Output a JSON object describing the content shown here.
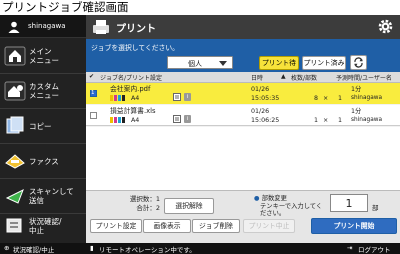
{
  "caption": "プリントジョブ確認画面",
  "sidebar": {
    "user": "shinagawa",
    "items": [
      {
        "label": "メイン\nメニュー"
      },
      {
        "label": "カスタム\nメニュー"
      },
      {
        "label": "コピー"
      },
      {
        "label": "ファクス"
      },
      {
        "label": "スキャンして\n送信"
      },
      {
        "label": "状況確認/\n中止"
      }
    ]
  },
  "header": {
    "title": "プリント"
  },
  "toolbar": {
    "instruction": "ジョブを選択してください。",
    "filter_value": "個人",
    "tab_waiting": "プリント待ち",
    "tab_done": "プリント済み"
  },
  "columns": {
    "name": "ジョブ名/プリント設定",
    "date": "日時",
    "sort_mark": "▲",
    "copies": "枚数/部数",
    "sched": "予測時間/ユーザー名"
  },
  "jobs": [
    {
      "name": "会社案内.pdf",
      "paper": "A4",
      "date": "01/26",
      "time": "15:05:35",
      "sheets": "8",
      "times": "×",
      "copies": "1",
      "duration": "1分",
      "user": "shinagawa",
      "selected": true,
      "seq": "1"
    },
    {
      "name": "損益計算書.xls",
      "paper": "A4",
      "date": "01/26",
      "time": "15:06:25",
      "sheets": "1",
      "times": "×",
      "copies": "1",
      "duration": "1分",
      "user": "shinagawa",
      "selected": false,
      "seq": ""
    }
  ],
  "footer": {
    "selected_count_label": "選択数：1",
    "total_label": "合計：2",
    "deselect": "選択解除",
    "copy_change_title": "部数変更",
    "copy_change_hint": "テンキーで入力してください。",
    "copy_value": "1",
    "copy_unit": "部",
    "btn_settings": "プリント設定",
    "btn_preview": "画像表示",
    "btn_delete": "ジョブ削除",
    "btn_stop": "プリント中止",
    "btn_start": "プリント開始"
  },
  "status": {
    "left": "状況確認/中止",
    "middle": "リモートオペレーション中です。",
    "right": "ログアウト"
  },
  "colors": {
    "accent_blue": "#1f5fa6",
    "selection_yellow": "#f9ec3e",
    "dark_bg": "#222222"
  }
}
